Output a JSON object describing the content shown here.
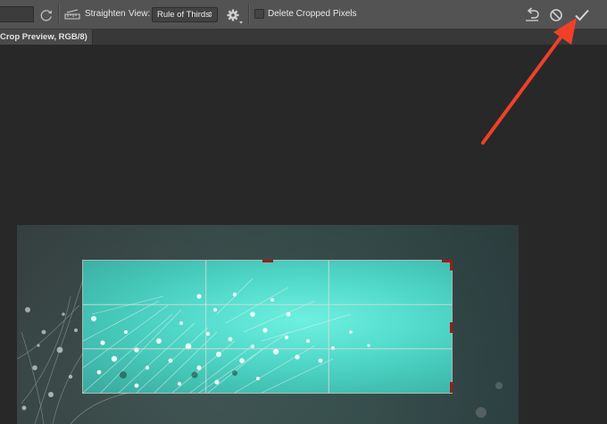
{
  "options_bar": {
    "straighten_label": "Straighten",
    "view_label": "View:",
    "view_select": {
      "selected": "Rule of Thirds",
      "chevron": "⇕"
    },
    "delete_cropped_label": "Delete Cropped Pixels",
    "delete_cropped_checked": false,
    "icons": {
      "swap": "rotate-arrows-icon",
      "straighten": "straighten-ruler-icon",
      "settings": "gear-icon",
      "reset": "reset-icon",
      "cancel": "cancel-icon",
      "commit": "checkmark-icon"
    }
  },
  "document_tab": {
    "title": "Crop Preview, RGB/8)"
  },
  "colors": {
    "panel": "#535353",
    "canvas": "#282828",
    "crop_handle": "#a11a1a",
    "annotation_arrow": "#f0402a",
    "image_teal": "#54dccd"
  },
  "annotation": {
    "type": "arrow",
    "points_to": "checkmark-icon"
  }
}
